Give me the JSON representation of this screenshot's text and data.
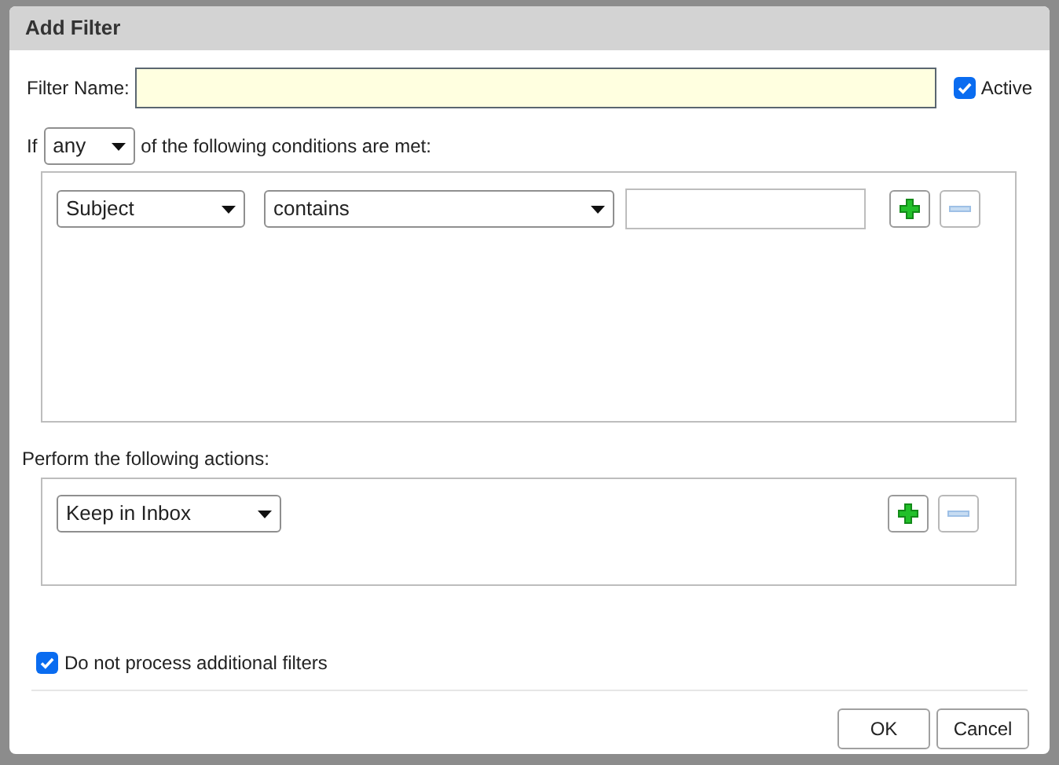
{
  "dialog": {
    "title": "Add Filter"
  },
  "filter_name": {
    "label": "Filter Name:"
  },
  "active": {
    "label": "Active",
    "checked": true
  },
  "match": {
    "prefix": "If",
    "value": "any",
    "suffix": "of the following conditions are met:"
  },
  "conditions": [
    {
      "field": "Subject",
      "operator": "contains",
      "remove_disabled": true
    }
  ],
  "actions_label": "Perform the following actions:",
  "actions": [
    {
      "action": "Keep in Inbox",
      "remove_disabled": true
    }
  ],
  "stop_processing": {
    "label": "Do not process additional filters",
    "checked": true
  },
  "buttons": [
    {
      "label": "OK"
    },
    {
      "label": "Cancel"
    }
  ]
}
